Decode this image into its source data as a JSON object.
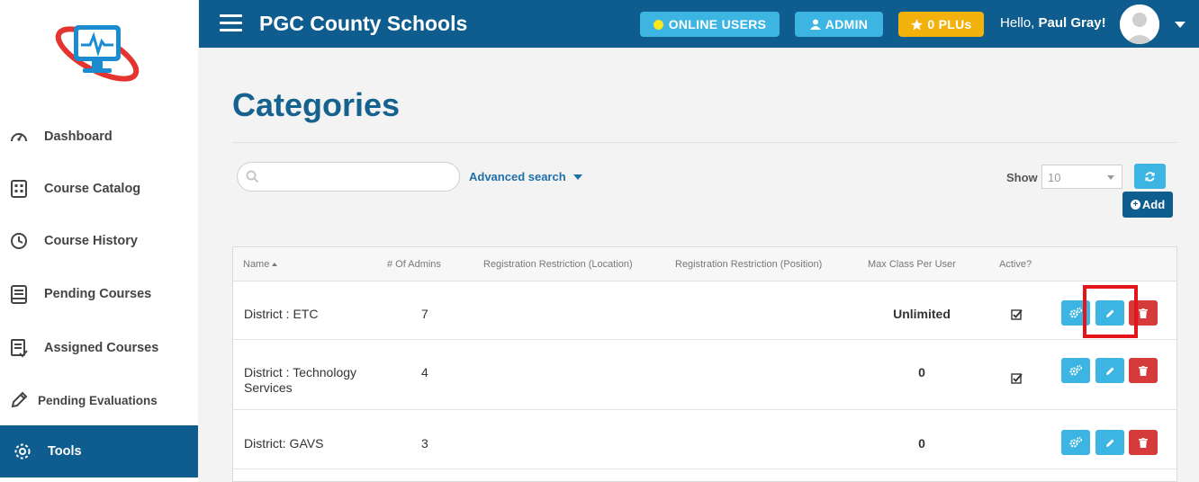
{
  "sidebar": {
    "items": [
      {
        "label": "Dashboard",
        "icon": "gauge-icon",
        "active": false
      },
      {
        "label": "Course Catalog",
        "icon": "catalog-icon",
        "active": false
      },
      {
        "label": "Course History",
        "icon": "history-clock-icon",
        "active": false
      },
      {
        "label": "Pending Courses",
        "icon": "book-icon",
        "active": false
      },
      {
        "label": "Assigned Courses",
        "icon": "assigned-list-icon",
        "active": false
      },
      {
        "label": "Pending Evaluations",
        "icon": "pencil-icon",
        "active": false
      },
      {
        "label": "Tools",
        "icon": "gear-icon",
        "active": true
      }
    ]
  },
  "header": {
    "title": "PGC County Schools",
    "online_users": "ONLINE USERS",
    "admin": "ADMIN",
    "plus": "0 PLUs",
    "greeting": "Hello,",
    "user_name": "Paul Gray!"
  },
  "page": {
    "title": "Categories"
  },
  "toolbar": {
    "search_placeholder": "",
    "advanced_search": "Advanced search",
    "show_label": "Show",
    "show_value": "10",
    "add_label": "Add"
  },
  "table": {
    "columns": [
      "Name",
      "# Of Admins",
      "Registration Restriction (Location)",
      "Registration Restriction (Position)",
      "Max Class Per User",
      "Active?"
    ],
    "rows": [
      {
        "name": "District : ETC",
        "admins": "7",
        "location": "",
        "position": "",
        "max_class": "Unlimited",
        "active": true
      },
      {
        "name": "District : Technology Services",
        "admins": "4",
        "location": "",
        "position": "",
        "max_class": "0",
        "active": true
      },
      {
        "name": "District: GAVS",
        "admins": "3",
        "location": "",
        "position": "",
        "max_class": "0",
        "active": false
      }
    ]
  },
  "colors": {
    "primary": "#0e5d8e",
    "info": "#3cb5e2",
    "warning": "#f2b10b",
    "danger": "#d63b3b",
    "highlight": "#e4141b"
  }
}
